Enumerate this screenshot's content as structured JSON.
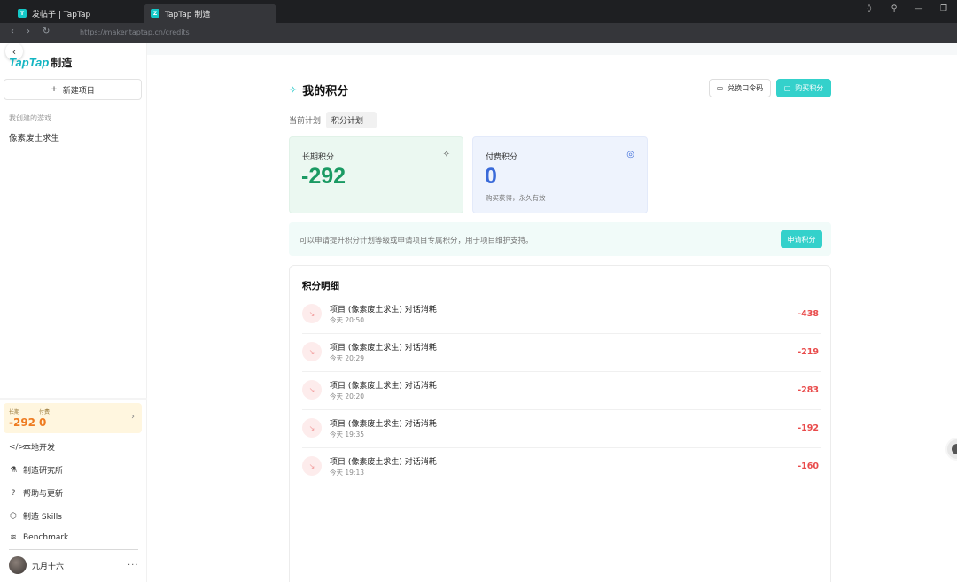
{
  "browser": {
    "tabs": [
      {
        "title": "发帖子 | TapTap",
        "favicon": "T"
      },
      {
        "title": "TapTap 制造",
        "favicon": "Z"
      }
    ],
    "url": "https://maker.taptap.cn/credits"
  },
  "sidebar": {
    "logo_text": "TapTap",
    "logo_suffix": "制造",
    "new_project_label": "新建项目",
    "section_label": "我创建的游戏",
    "games": [
      "像素废土求生"
    ],
    "credits": {
      "long_label": "长期",
      "long_value": "-292",
      "paid_label": "付费",
      "paid_value": "0"
    },
    "menu": [
      {
        "icon": "code-icon",
        "label": "本地开发"
      },
      {
        "icon": "flask-icon",
        "label": "制造研究所"
      },
      {
        "icon": "help-icon",
        "label": "帮助与更新"
      },
      {
        "icon": "cube-icon",
        "label": "制造 Skills"
      },
      {
        "icon": "chart-icon",
        "label": "Benchmark"
      }
    ],
    "user": {
      "name": "九月十六",
      "more": "···"
    }
  },
  "main": {
    "title": "我的积分",
    "redeem_button": "兑换口令码",
    "buy_button": "购买积分",
    "plan_label": "当前计划",
    "plan_value": "积分计划一",
    "long_term": {
      "label": "长期积分",
      "value": "-292"
    },
    "paid": {
      "label": "付费积分",
      "value": "0",
      "note": "购买获得，永久有效"
    },
    "banner_text": "可以申请提升积分计划等级或申请项目专属积分，用于项目维护支持。",
    "apply_button": "申请积分",
    "detail_title": "积分明细",
    "transactions": [
      {
        "title": "项目 (像素废土求生) 对话消耗",
        "time": "今天 20:50",
        "amount": "-438"
      },
      {
        "title": "项目 (像素废土求生) 对话消耗",
        "time": "今天 20:29",
        "amount": "-219"
      },
      {
        "title": "项目 (像素废土求生) 对话消耗",
        "time": "今天 20:20",
        "amount": "-283"
      },
      {
        "title": "项目 (像素废土求生) 对话消耗",
        "time": "今天 19:35",
        "amount": "-192"
      },
      {
        "title": "项目 (像素废土求生) 对话消耗",
        "time": "今天 19:13",
        "amount": "-160"
      }
    ]
  },
  "colors": {
    "accent": "#34d1cb",
    "long_term_value": "#1a9a63",
    "paid_value": "#3a6ad9",
    "negative": "#e94b4b",
    "sidebar_credit": "#ee7c22"
  }
}
